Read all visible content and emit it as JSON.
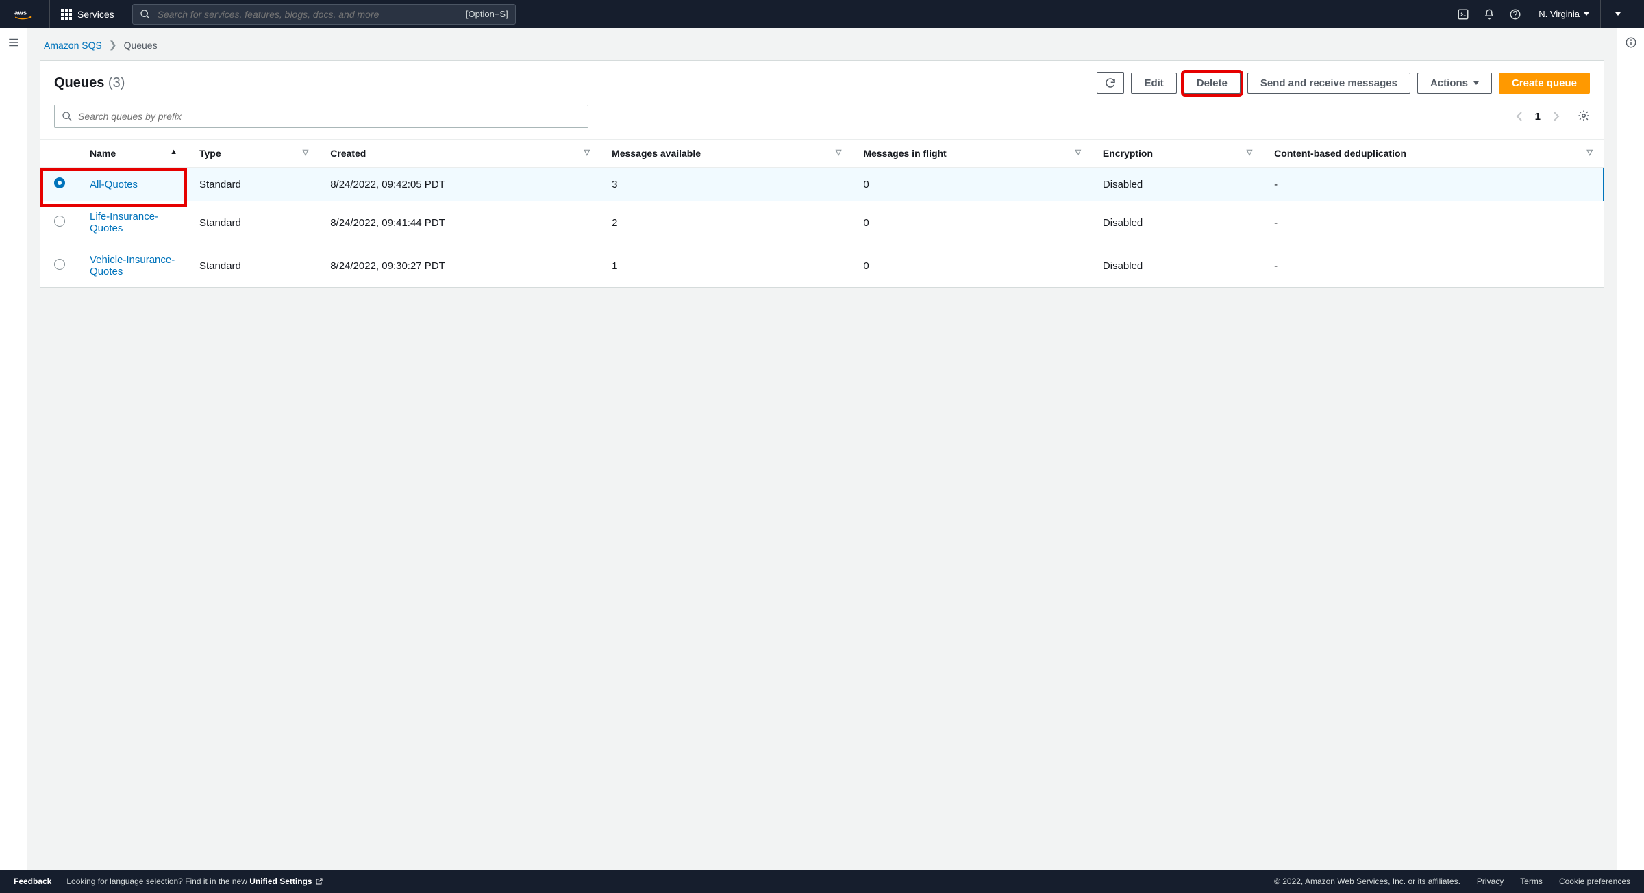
{
  "topnav": {
    "services_label": "Services",
    "search_placeholder": "Search for services, features, blogs, docs, and more",
    "search_shortcut": "[Option+S]",
    "region": "N. Virginia"
  },
  "breadcrumb": {
    "root": "Amazon SQS",
    "current": "Queues"
  },
  "panel": {
    "title": "Queues",
    "count_display": "(3)",
    "count": 3
  },
  "actions": {
    "refresh": "Refresh",
    "edit": "Edit",
    "delete": "Delete",
    "send_receive": "Send and receive messages",
    "actions": "Actions",
    "create": "Create queue"
  },
  "filter": {
    "placeholder": "Search queues by prefix",
    "page": "1"
  },
  "columns": {
    "name": "Name",
    "type": "Type",
    "created": "Created",
    "messages_available": "Messages available",
    "messages_in_flight": "Messages in flight",
    "encryption": "Encryption",
    "content_dedup": "Content-based deduplication"
  },
  "rows": [
    {
      "selected": true,
      "name": "All-Quotes",
      "type": "Standard",
      "created": "8/24/2022, 09:42:05 PDT",
      "available": "3",
      "in_flight": "0",
      "encryption": "Disabled",
      "dedup": "-"
    },
    {
      "selected": false,
      "name": "Life-Insurance-Quotes",
      "type": "Standard",
      "created": "8/24/2022, 09:41:44 PDT",
      "available": "2",
      "in_flight": "0",
      "encryption": "Disabled",
      "dedup": "-"
    },
    {
      "selected": false,
      "name": "Vehicle-Insurance-Quotes",
      "type": "Standard",
      "created": "8/24/2022, 09:30:27 PDT",
      "available": "1",
      "in_flight": "0",
      "encryption": "Disabled",
      "dedup": "-"
    }
  ],
  "footer": {
    "feedback": "Feedback",
    "lang_prefix": "Looking for language selection? Find it in the new ",
    "unified_settings": "Unified Settings",
    "copyright": "© 2022, Amazon Web Services, Inc. or its affiliates.",
    "privacy": "Privacy",
    "terms": "Terms",
    "cookie": "Cookie preferences"
  }
}
